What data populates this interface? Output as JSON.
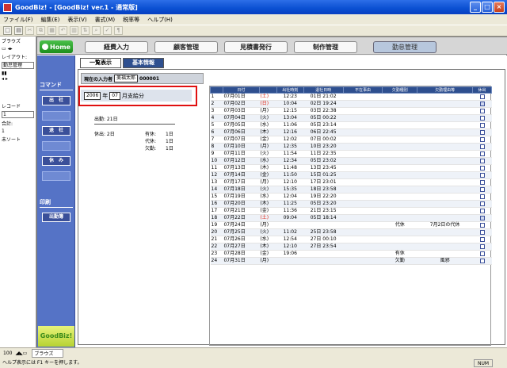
{
  "window": {
    "title": "GoodBiz! - [GoodBiz! ver.1 - 通常版]"
  },
  "menu": [
    "ファイル(F)",
    "編集(E)",
    "表示(V)",
    "書式(M)",
    "税率等",
    "ヘルプ(H)"
  ],
  "left": {
    "browse": "ブラウズ",
    "layout_label": "レイアウト:",
    "layout_value": "勤怠管理",
    "record_label": "レコード",
    "record_value": "1",
    "total_label": "合計:",
    "total_value": "1",
    "sort": "未ソート"
  },
  "nav": {
    "home": "Home",
    "tabs": [
      "経費入力",
      "顧客管理",
      "見積書発行",
      "制作管理",
      "勤怠管理"
    ]
  },
  "sidebar": {
    "command": "コマンド",
    "btn_in": "出　社",
    "btn_out": "退　社",
    "btn_rest": "休　み",
    "print": "印刷",
    "btn_print": "出勤簿",
    "brand": "GoodBiz!"
  },
  "subtabs": [
    "一覧表示",
    "基本情報"
  ],
  "input": {
    "label": "現在の入力者",
    "name": "美福太郎",
    "id": "000001"
  },
  "month": {
    "year": "2006",
    "year_suffix": "年",
    "month": "07",
    "month_suffix": "月支給分"
  },
  "summary": {
    "work": "出勤: 21日",
    "absent": "休出: 2日",
    "yukyu": "有休:",
    "yukyu_v": "1日",
    "daikyu": "代休:",
    "daikyu_v": "1日",
    "kekkin": "欠勤:",
    "kekkin_v": "1日"
  },
  "table": {
    "headers": [
      "",
      "日付",
      "",
      "出社時刻",
      "退社日時",
      "不在事由",
      "欠勤種別",
      "欠勤理由等",
      "休出"
    ],
    "rows": [
      [
        "1",
        "07月01日",
        "(土)",
        "12:23",
        "01日 21:02",
        "",
        "",
        "",
        false
      ],
      [
        "2",
        "07月02日",
        "(日)",
        "10:04",
        "02日 19:24",
        "",
        "",
        "",
        true
      ],
      [
        "3",
        "07月03日",
        "(月)",
        "12:15",
        "03日 22:38",
        "",
        "",
        "",
        false
      ],
      [
        "4",
        "07月04日",
        "(火)",
        "13:04",
        "05日 00:22",
        "",
        "",
        "",
        false
      ],
      [
        "5",
        "07月05日",
        "(水)",
        "11:06",
        "05日 23:14",
        "",
        "",
        "",
        false
      ],
      [
        "6",
        "07月06日",
        "(木)",
        "12:16",
        "06日 22:45",
        "",
        "",
        "",
        false
      ],
      [
        "7",
        "07月07日",
        "(金)",
        "12:02",
        "07日 00:02",
        "",
        "",
        "",
        false
      ],
      [
        "8",
        "07月10日",
        "(月)",
        "12:35",
        "10日 23:20",
        "",
        "",
        "",
        false
      ],
      [
        "9",
        "07月11日",
        "(火)",
        "11:54",
        "11日 22:35",
        "",
        "",
        "",
        false
      ],
      [
        "10",
        "07月12日",
        "(水)",
        "12:34",
        "05日 23:02",
        "",
        "",
        "",
        false
      ],
      [
        "11",
        "07月13日",
        "(木)",
        "11:48",
        "13日 23:45",
        "",
        "",
        "",
        false
      ],
      [
        "12",
        "07月14日",
        "(金)",
        "11:50",
        "15日 01:25",
        "",
        "",
        "",
        false
      ],
      [
        "13",
        "07月17日",
        "(月)",
        "12:10",
        "17日 23:01",
        "",
        "",
        "",
        false
      ],
      [
        "14",
        "07月18日",
        "(火)",
        "15:35",
        "18日 23:58",
        "",
        "",
        "",
        false
      ],
      [
        "15",
        "07月19日",
        "(水)",
        "12:04",
        "19日 22:20",
        "",
        "",
        "",
        false
      ],
      [
        "16",
        "07月20日",
        "(木)",
        "11:25",
        "05日 23:20",
        "",
        "",
        "",
        false
      ],
      [
        "17",
        "07月21日",
        "(金)",
        "11:36",
        "21日 23:15",
        "",
        "",
        "",
        false
      ],
      [
        "18",
        "07月22日",
        "(土)",
        "09:04",
        "05日 18:14",
        "",
        "",
        "",
        true
      ],
      [
        "19",
        "07月24日",
        "(月)",
        "",
        "",
        "",
        "代休",
        "7月2日の代休",
        false
      ],
      [
        "20",
        "07月25日",
        "(火)",
        "11:02",
        "25日 23:58",
        "",
        "",
        "",
        false
      ],
      [
        "21",
        "07月26日",
        "(水)",
        "12:54",
        "27日 00:10",
        "",
        "",
        "",
        false
      ],
      [
        "22",
        "07月27日",
        "(木)",
        "12:10",
        "27日 23:54",
        "",
        "",
        "",
        false
      ],
      [
        "23",
        "07月28日",
        "(金)",
        "19:06",
        "",
        "",
        "有休",
        "",
        false
      ],
      [
        "24",
        "07月31日",
        "(月)",
        "",
        "",
        "",
        "欠勤",
        "風邪",
        false
      ]
    ]
  },
  "status": {
    "zoom": "100",
    "mode": "ブラウズ",
    "hint": "ヘルプ表示には F1 キーを押します。",
    "num": "NUM"
  }
}
